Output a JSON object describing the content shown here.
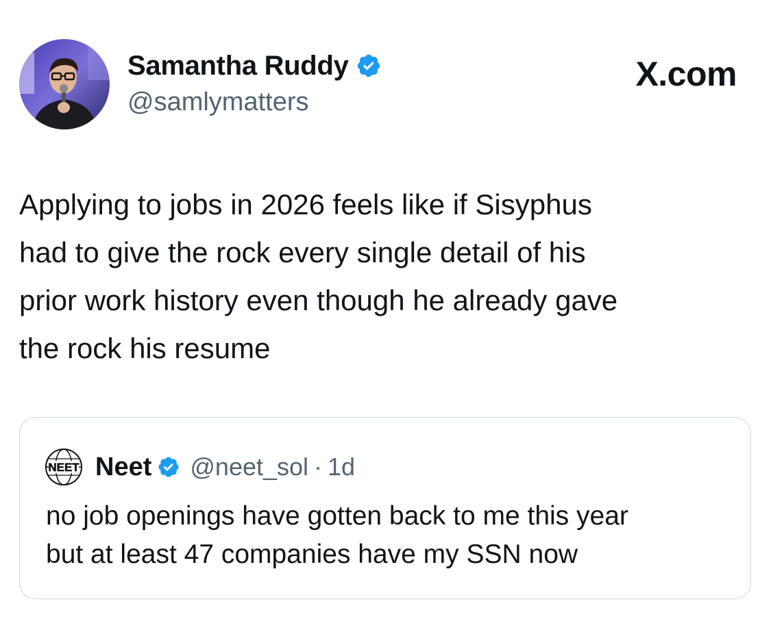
{
  "header": {
    "display_name": "Samantha Ruddy",
    "handle": "@samlymatters",
    "brand": "X.com",
    "verified_icon": "verified-badge-icon",
    "avatar_icon": "profile-photo-avatar"
  },
  "tweet": {
    "text": "Applying to jobs in 2026 feels like if Sisyphus\nhad to give the rock every single detail of his\nprior work history even though he already gave\nthe rock his resume"
  },
  "quote": {
    "display_name": "Neet",
    "handle": "@neet_sol",
    "separator": "·",
    "time": "1d",
    "text": "no job openings have gotten back to me this year\nbut at least 47 companies have my SSN now",
    "avatar_icon": "neet-logo-avatar"
  },
  "colors": {
    "text_primary": "#0f1419",
    "text_secondary": "#536471",
    "verified_blue": "#1d9bf0",
    "border": "#cfd9de"
  }
}
